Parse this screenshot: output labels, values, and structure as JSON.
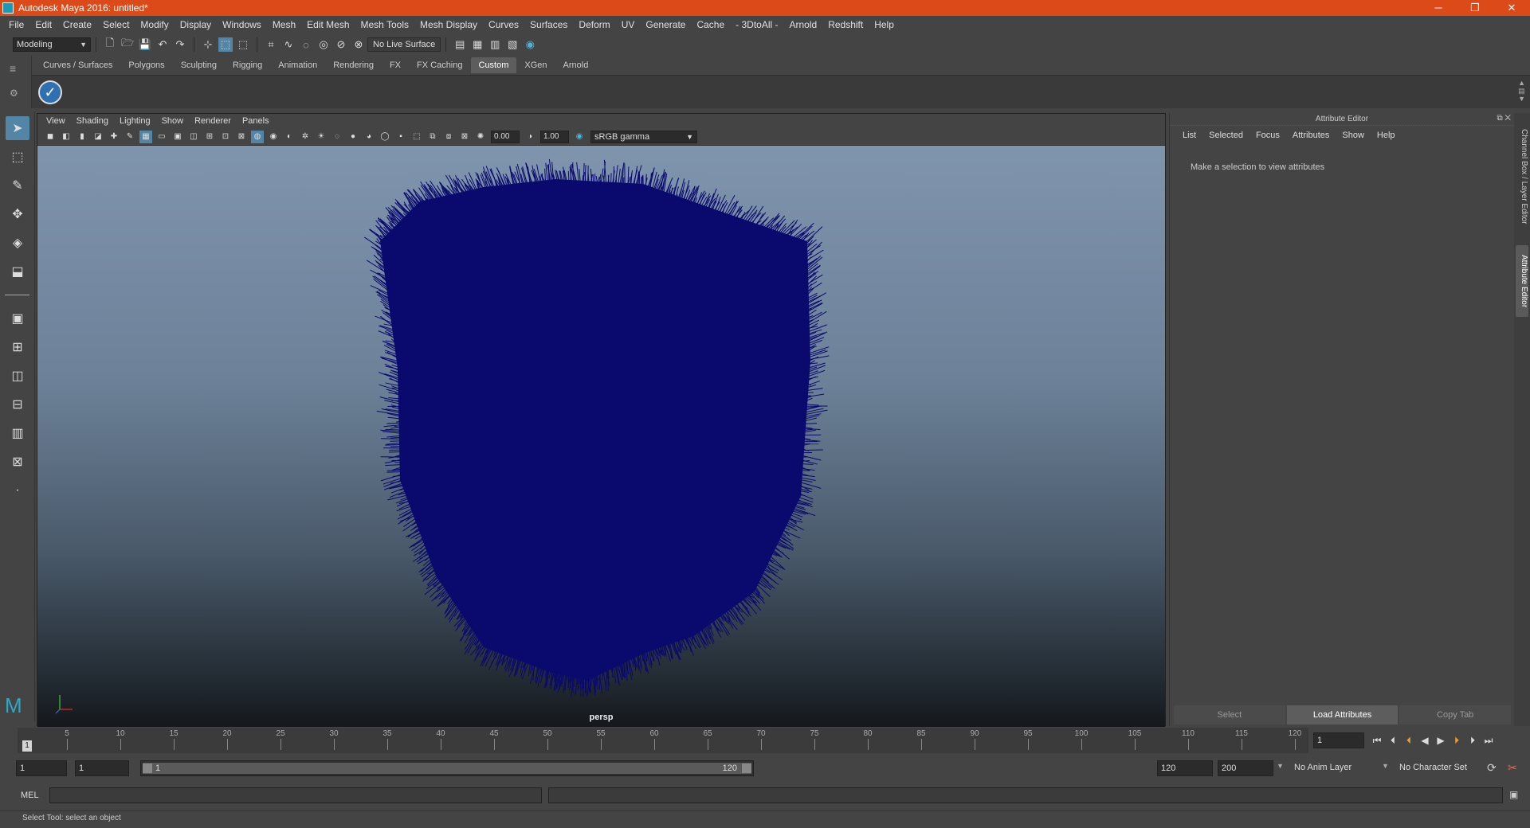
{
  "window": {
    "title": "Autodesk Maya 2016: untitled*",
    "minimize": "─",
    "maximize": "❐",
    "close": "✕"
  },
  "menubar": [
    "File",
    "Edit",
    "Create",
    "Select",
    "Modify",
    "Display",
    "Windows",
    "Mesh",
    "Edit Mesh",
    "Mesh Tools",
    "Mesh Display",
    "Curves",
    "Surfaces",
    "Deform",
    "UV",
    "Generate",
    "Cache",
    "- 3DtoAll -",
    "Arnold",
    "Redshift",
    "Help"
  ],
  "statusline": {
    "mode": "Modeling",
    "live_surface": "No Live Surface"
  },
  "shelf": {
    "tabs": [
      "Curves / Surfaces",
      "Polygons",
      "Sculpting",
      "Rigging",
      "Animation",
      "Rendering",
      "FX",
      "FX Caching",
      "Custom",
      "XGen",
      "Arnold"
    ],
    "active_tab": "Custom"
  },
  "viewport": {
    "menu": [
      "View",
      "Shading",
      "Lighting",
      "Show",
      "Renderer",
      "Panels"
    ],
    "exposure": "0.00",
    "gamma": "1.00",
    "color_space": "sRGB gamma",
    "camera": "persp",
    "object_color": "#0a0a6e"
  },
  "attribute_editor": {
    "title": "Attribute Editor",
    "menu": [
      "List",
      "Selected",
      "Focus",
      "Attributes",
      "Show",
      "Help"
    ],
    "message": "Make a selection to view attributes",
    "buttons": [
      "Select",
      "Load Attributes",
      "Copy Tab"
    ]
  },
  "side_tabs": [
    "Channel Box / Layer Editor",
    "Attribute Editor"
  ],
  "timeline": {
    "ticks": [
      "5",
      "10",
      "15",
      "20",
      "25",
      "30",
      "35",
      "40",
      "45",
      "50",
      "55",
      "60",
      "65",
      "70",
      "75",
      "80",
      "85",
      "90",
      "95",
      "100",
      "105",
      "110",
      "115",
      "120"
    ],
    "current_frame": "1",
    "current_frame_field": "1"
  },
  "range": {
    "start": "1",
    "playback_start": "1",
    "slider_start": "1",
    "slider_end": "120",
    "playback_end": "120",
    "end": "200",
    "anim_layer": "No Anim Layer",
    "character_set": "No Character Set"
  },
  "command_line": {
    "label": "MEL"
  },
  "help_line": "Select Tool: select an object"
}
